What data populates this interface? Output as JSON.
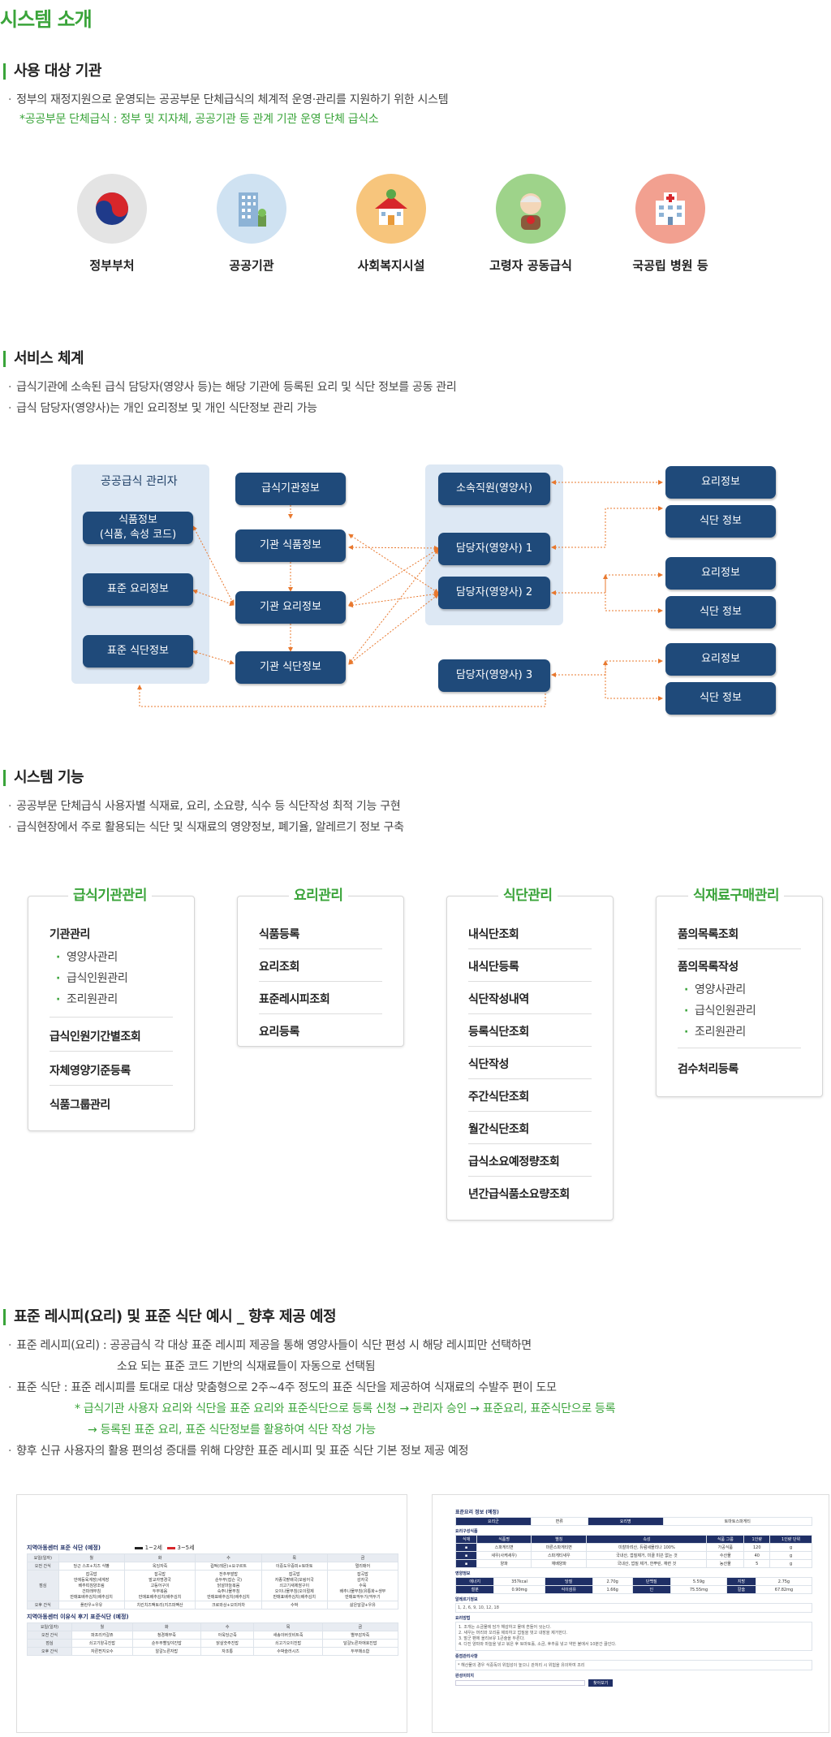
{
  "title": "시스템 소개",
  "sections": {
    "target": {
      "heading": "사용 대상 기관",
      "bullet": "정부의 재정지원으로 운영되는 공공부문 단체급식의 체계적 운영·관리를 지원하기 위한 시스템",
      "note": "*공공부문 단체급식 : 정부 및 지자체, 공공기관 등 관계 기관 운영 단체 급식소",
      "institutions": [
        "정부부처",
        "공공기관",
        "사회복지시설",
        "고령자 공동급식",
        "국공립 병원 등"
      ]
    },
    "service": {
      "heading": "서비스 체계",
      "bullets": [
        "급식기관에 소속된 급식 담당자(영양사 등)는 해당 기관에 등록된 요리 및 식단 정보를 공동 관리",
        "급식 담당자(영양사)는 개인 요리정보 및 개인 식단정보 관리 가능"
      ],
      "diagram": {
        "admin_title": "공공급식 관리자",
        "admin_items": [
          "식품정보\n(식품, 속성 코드)",
          "표준 요리정보",
          "표준 식단정보"
        ],
        "inst_items": [
          "급식기관정보",
          "기관 식품정보",
          "기관 요리정보",
          "기관 식단정보"
        ],
        "staff_items": [
          "소속직원(영양사)",
          "담당자(영양사) 1",
          "담당자(영양사) 2"
        ],
        "staff3": "담당자(영양사) 3",
        "personal": [
          "요리정보",
          "식단 정보",
          "요리정보",
          "식단 정보",
          "요리정보",
          "식단 정보"
        ]
      }
    },
    "functions": {
      "heading": "시스템 기능",
      "bullets": [
        "공공부문 단체급식 사용자별 식재료, 요리, 소요량, 식수 등 식단작성 최적 기능 구현",
        "급식현장에서 주로 활용되는 식단 및 식재료의 영양정보, 폐기율, 알레르기 정보 구축"
      ],
      "cards": [
        {
          "title": "급식기관관리",
          "group": "기관관리",
          "subs": [
            "영양사관리",
            "급식인원관리",
            "조리원관리"
          ],
          "items": [
            "급식인원기간별조회",
            "자체영양기준등록",
            "식품그룹관리"
          ]
        },
        {
          "title": "요리관리",
          "items": [
            "식품등록",
            "요리조회",
            "표준레시피조회",
            "요리등록"
          ]
        },
        {
          "title": "식단관리",
          "items": [
            "내식단조회",
            "내식단등록",
            "식단작성내역",
            "등록식단조회",
            "식단작성",
            "주간식단조회",
            "월간식단조회",
            "급식소요예정량조회",
            "년간급식품소요량조회"
          ]
        },
        {
          "title": "식재료구매관리",
          "item1": "품의목록조회",
          "group": "품의목록작성",
          "subs": [
            "영양사관리",
            "급식인원관리",
            "조리원관리"
          ],
          "item2": "검수처리등록"
        }
      ]
    },
    "standard": {
      "heading": "표준 레시피(요리) 및 표준 식단 예시 _ 향후 제공 예정",
      "b1_line1": "표준 레시피(요리) : 공공급식 각 대상 표준 레시피 제공을 통해 영양사들이 식단 편성 시 해당 레시피만 선택하면",
      "b1_line2": "소요 되는 표준 코드 기반의 식재료들이 자동으로 선택됨",
      "b2": "표준 식단 : 표준 레시피를 토대로 대상 맞춤형으로 2주~4주 정도의 표준 식단을 제공하여 식재료의 수발주 편이 도모",
      "note1": "* 급식기관 사용자 요리와 식단을 표준 요리와 표준식단으로 등록 신청 → 관리자 승인 → 표준요리, 표준식단으로 등록",
      "note2": "→ 등록된 표준 요리, 표준 식단정보를 활용하여 식단 작성 가능",
      "b3": "향후 신규 사용자의 활용 편의성 증대를 위해 다양한 표준 레시피 및 표준 식단 기본 정보 제공 예정"
    },
    "sample_left": {
      "title": "지역아동센터 표준 식단 (예정)",
      "legend": [
        "1~2세",
        "3~5세"
      ],
      "days": [
        "요일(일자)",
        "월",
        "화",
        "수",
        "목",
        "금"
      ],
      "rows": [
        [
          "오전 간식",
          "당근 스프+치즈 식빵",
          "옥잉자죽",
          "컵떡(레몬)+요구르트",
          "이중도우증피+토마토",
          "멀리매어"
        ],
        [
          "점심",
          "잡곡밥\n만에등육계장(새계장\n베추띠침양조림\n건파래무침\n만매표배추김치(배추김치",
          "잡곡밥\n발교자명경국\n고등어구이\n두부볶음\n만매표배추김치(배추김치",
          "전추무발밥\n순두부(잡슨 국)\n닭살마늘볶음\n숙주나물무침\n만매표배추김치(배추김치",
          "잡곡밥\n자종국팥배국(모링어국\n쇠고기새제쌈구이\n오이나물무침(오이절제\n만매표배추김치(배추김치",
          "잡곡밥\n감자국\n수육\n배추나물무침(유통화+생무\n만매표깍두기(깍두기"
        ],
        [
          "오후 간식",
          "플란우+우유",
          "치킨치즈팩토리(지즈파팩산",
          "크로와상+오미자차",
          "수박",
          "삶은달걀+우유"
        ]
      ],
      "title2": "지역아동센터 이유식 후기 표준식단 (예정)",
      "rows2": [
        [
          "오전 간식",
          "파프리카갈쥬",
          "청경채무죽",
          "아욱당근죽",
          "새송이버섯비트죽",
          "별무감자죽"
        ],
        [
          "점심",
          "쇠고기양곡진밥",
          "순두부빨잎야진밥",
          "닭살숫주진밥",
          "쇠고기오이진밥",
          "달걀노른자애호진밥"
        ],
        [
          "오후 간식",
          "자른찐지오수",
          "알갈노른자밥",
          "자조통",
          "수박슬러시즈",
          "두부매소합"
        ]
      ]
    },
    "sample_right": {
      "title": "표준요리 정보 (예정)",
      "head": [
        "요리군",
        "면류",
        "요리명",
        "토마토스파게티"
      ],
      "ing_title": "요리구성식품",
      "ing_cols": [
        "식재",
        "식품명",
        "별칭",
        "속성",
        "식품 그룹",
        "1인량",
        "1인량 단위"
      ],
      "ing_rows": [
        [
          "스파게티면",
          "마른스파게티면",
          "미찰마려산, 듀럼세몰리나 100%",
          "가공식품",
          "120",
          "g"
        ],
        [
          "새우(사케새우)",
          "스파게티새우",
          "국내산, 껍질제거, 미끌 미끈 없는 것",
          "수산물",
          "40",
          "g"
        ],
        [
          "양파",
          "재배양파",
          "국내산, 껍질 제거, 한뿌린, 재련 것",
          "농산물",
          "5",
          "g"
        ]
      ],
      "nut_title": "영양정보",
      "nut": [
        "에너지",
        "357kcal",
        "당질",
        "2.70g",
        "단백질",
        "5.59g",
        "지방",
        "2.75g",
        "철분",
        "0.90mg",
        "식이섬유",
        "1.66g",
        "인",
        "75.55mg",
        "칼슘",
        "67.82mg"
      ],
      "allergy_title": "알레르기정보",
      "allergy": "1, 2, 6, 9, 10, 12, 18",
      "method_title": "요리방법",
      "methods": [
        "1. 조개는 소금물에 담가 해감하고 물에 흔들어 씻는다.",
        "2. 새우는 머리와 꼬리를 제외하고 껍질을 벗고 내장을 제거한다.",
        "3. 말군 팬에 올리브유 1큰술을 두른다.",
        "4. 다진 양파와 마늘을 넣고 볶은 후 토마토홀, 소금, 후추를 넣고 약한 불에서 10분간 끓인다."
      ],
      "caution_title": "중점관리사항",
      "caution": "* 해산물의 경우 식중독의 위험성이 높으니 관처리 시 위험을 유의하여 조리",
      "image_title": "완성이미지",
      "find_btn": "찾아보기"
    }
  },
  "colors": {
    "green": "#3aa43a",
    "navy": "#1f4a7a",
    "panel": "#dde8f4",
    "arrow": "#e8782e"
  }
}
